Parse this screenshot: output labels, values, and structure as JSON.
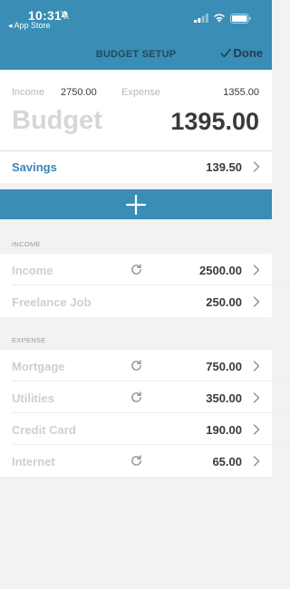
{
  "status_bar": {
    "time": "10:31",
    "back_label": "◂ App Store"
  },
  "nav": {
    "title": "BUDGET SETUP",
    "done_label": "Done"
  },
  "summary": {
    "income_label": "Income",
    "income_value": "2750.00",
    "expense_label": "Expense",
    "expense_value": "1355.00",
    "budget_label": "Budget",
    "budget_value": "1395.00"
  },
  "savings": {
    "label": "Savings",
    "value": "139.50"
  },
  "income_section": {
    "header": "INCOME",
    "items": [
      {
        "label": "Income",
        "value": "2500.00",
        "recurring": true
      },
      {
        "label": "Freelance Job",
        "value": "250.00",
        "recurring": false
      }
    ]
  },
  "expense_section": {
    "header": "EXPENSE",
    "items": [
      {
        "label": "Mortgage",
        "value": "750.00",
        "recurring": true
      },
      {
        "label": "Utilities",
        "value": "350.00",
        "recurring": true
      },
      {
        "label": "Credit Card",
        "value": "190.00",
        "recurring": false
      },
      {
        "label": "Internet",
        "value": "65.00",
        "recurring": true
      }
    ]
  },
  "colors": {
    "accent": "#3a8db5",
    "savings_label": "#3a86b8",
    "muted_label": "#cfcfcf"
  },
  "icons": [
    "bell-off-icon",
    "cellular-signal-icon",
    "wifi-icon",
    "battery-icon",
    "checkmark-icon",
    "chevron-right-icon",
    "plus-icon",
    "repeat-icon"
  ]
}
